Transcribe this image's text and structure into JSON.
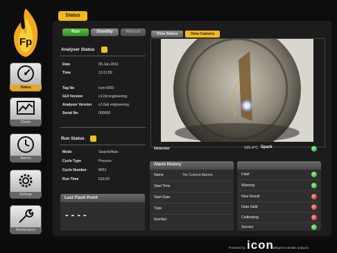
{
  "sidebar": {
    "logo_text": "Fp",
    "items": [
      {
        "label": "Status",
        "icon": "gauge-icon"
      },
      {
        "label": "Charts",
        "icon": "chart-icon"
      },
      {
        "label": "Alarms",
        "icon": "clock-icon"
      },
      {
        "label": "Settings",
        "icon": "gear-icon"
      },
      {
        "label": "Maintenance",
        "icon": "wrench-icon"
      }
    ],
    "active_index": 0
  },
  "header": {
    "tab_label": "Status"
  },
  "mode_buttons": {
    "run": "Run",
    "standby": "Standby",
    "manual": "Manual"
  },
  "analyser_status": {
    "title": "Analyser Status",
    "rows": [
      {
        "label": "Date",
        "value": "05-Jan-2011"
      },
      {
        "label": "Time",
        "value": "13:11:55"
      },
      {
        "label": "Tag No",
        "value": "icon-0001"
      },
      {
        "label": "GUI Version",
        "value": "v1.0d engineering"
      },
      {
        "label": "Analyser Version",
        "value": "v1.0ak engineering"
      },
      {
        "label": "Serial No",
        "value": "000000"
      }
    ]
  },
  "run_status": {
    "title": "Run Status",
    "rows": [
      {
        "label": "Mode",
        "value": "Search/Auto"
      },
      {
        "label": "Cycle Type",
        "value": "Process"
      },
      {
        "label": "Cycle Number",
        "value": "8651"
      },
      {
        "label": "Run Time",
        "value": "019:20"
      }
    ]
  },
  "last_flash": {
    "title": "Last Flash Point",
    "value": "----"
  },
  "video": {
    "tab_status": "View Status",
    "tab_camera": "View Camera",
    "detector_label": "Detector",
    "temperature": "185.4°C",
    "spark_label": "Spark"
  },
  "alarm_history": {
    "title": "Alarm History",
    "rows": [
      {
        "label": "Name",
        "value": "No Current Alarms"
      },
      {
        "label": "Start Time",
        "value": ""
      },
      {
        "label": "Start Date",
        "value": ""
      },
      {
        "label": "Type",
        "value": ""
      },
      {
        "label": "Number",
        "value": ""
      }
    ]
  },
  "status_list": {
    "rows": [
      {
        "label": "Fatal",
        "state": "green"
      },
      {
        "label": "Warning",
        "state": "green"
      },
      {
        "label": "New Result",
        "state": "red"
      },
      {
        "label": "Data Valid",
        "state": "red"
      },
      {
        "label": "Calibrating",
        "state": "red"
      },
      {
        "label": "Service",
        "state": "green"
      }
    ]
  },
  "footer": {
    "powered_by": "Powered by",
    "brand": "icon",
    "tagline": "intelligent scientific analysis"
  },
  "colors": {
    "accent": "#f2b820",
    "run_green": "#3f9a32",
    "status_green": "#2b9a2a",
    "status_red": "#c21c1c"
  }
}
